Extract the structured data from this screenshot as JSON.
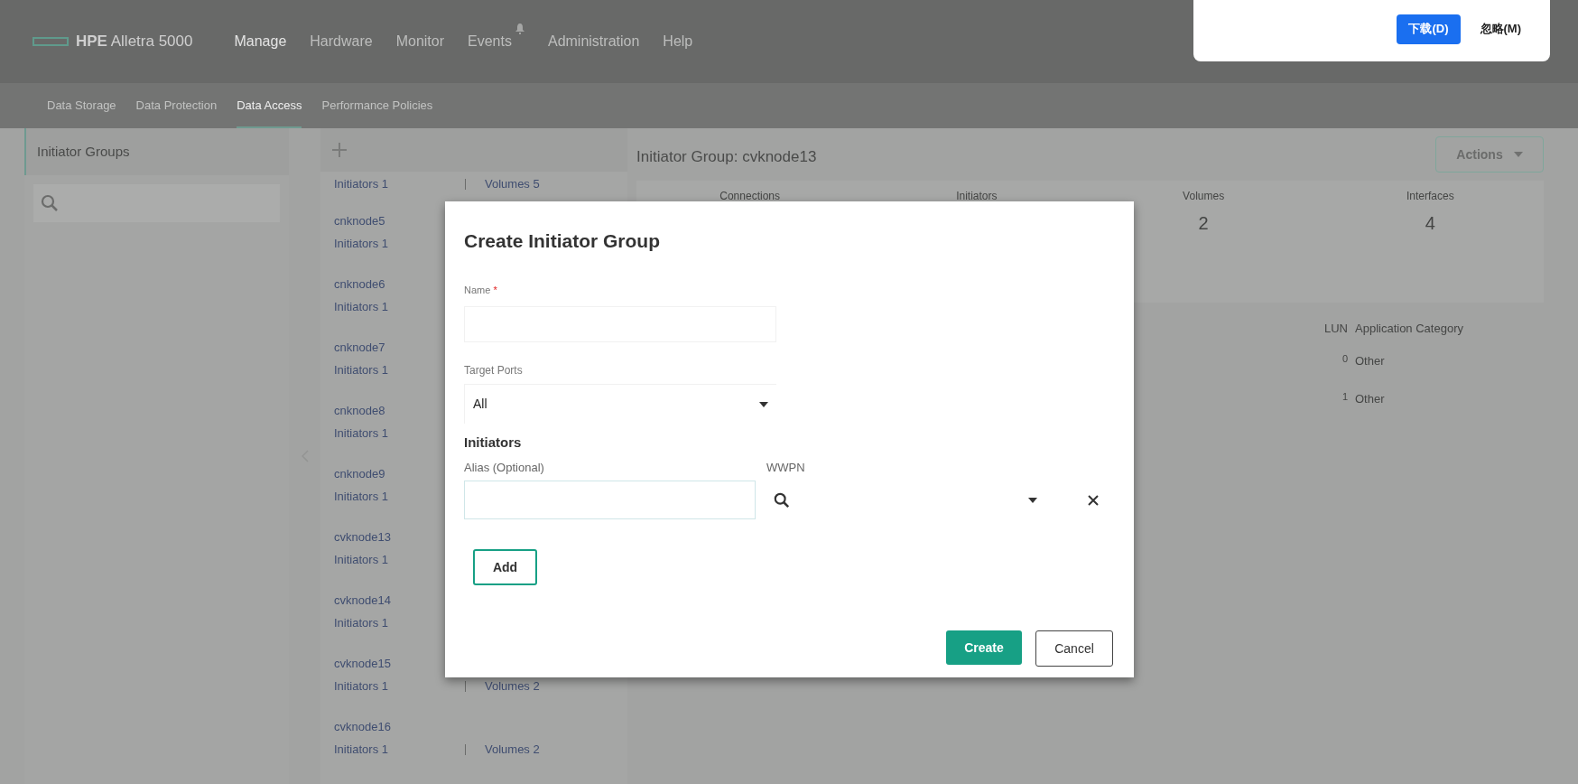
{
  "brand": {
    "name_bold": "HPE",
    "name": "Alletra 5000"
  },
  "nav": [
    {
      "label": "Manage",
      "selected": true,
      "bell": false
    },
    {
      "label": "Hardware",
      "selected": false,
      "bell": false
    },
    {
      "label": "Monitor",
      "selected": false,
      "bell": false
    },
    {
      "label": "Events",
      "selected": false,
      "bell": true
    },
    {
      "label": "Administration",
      "selected": false,
      "bell": false
    },
    {
      "label": "Help",
      "selected": false,
      "bell": false
    }
  ],
  "subnav": [
    {
      "label": "Data Storage",
      "selected": false
    },
    {
      "label": "Data Protection",
      "selected": false
    },
    {
      "label": "Data Access",
      "selected": true
    },
    {
      "label": "Performance Policies",
      "selected": false
    }
  ],
  "download_prompt": {
    "buttons": [
      {
        "label": "下载(D)",
        "kind": "primary"
      },
      {
        "label": "忽略(M)",
        "kind": "plain"
      }
    ]
  },
  "sidebar": {
    "title": "Initiator Groups"
  },
  "group_list": [
    {
      "initiators": "Initiators 1",
      "volumes": "Volumes 5"
    },
    {
      "name": "cnknode5",
      "initiators": "Initiators 1"
    },
    {
      "name": "cnknode6",
      "initiators": "Initiators 1"
    },
    {
      "name": "cnknode7",
      "initiators": "Initiators 1"
    },
    {
      "name": "cnknode8",
      "initiators": "Initiators 1"
    },
    {
      "name": "cnknode9",
      "initiators": "Initiators 1"
    },
    {
      "name": "cvknode13",
      "initiators": "Initiators 1"
    },
    {
      "name": "cvknode14",
      "initiators": "Initiators 1"
    },
    {
      "name": "cvknode15",
      "initiators": "Initiators 1",
      "volumes": "Volumes 2"
    },
    {
      "name": "cvknode16",
      "initiators": "Initiators 1",
      "volumes": "Volumes 2"
    }
  ],
  "detail": {
    "title": "Initiator Group: cvknode13",
    "actions": "Actions",
    "stats": [
      {
        "label": "Connections"
      },
      {
        "label": "Initiators"
      },
      {
        "label": "Volumes",
        "value": "2"
      },
      {
        "label": "Interfaces",
        "value": "4"
      }
    ],
    "columns": [
      "LUN",
      "Application Category"
    ],
    "rows": [
      {
        "lun": "0",
        "category": "Other"
      },
      {
        "lun": "1",
        "category": "Other"
      }
    ]
  },
  "dialog": {
    "title": "Create Initiator Group",
    "name_label": "Name",
    "required_mark": "*",
    "target_ports_label": "Target Ports",
    "target_ports_value": "All",
    "initiators_heading": "Initiators",
    "alias_label": "Alias (Optional)",
    "wwpn_label": "WWPN",
    "add": "Add",
    "create": "Create",
    "cancel": "Cancel"
  }
}
